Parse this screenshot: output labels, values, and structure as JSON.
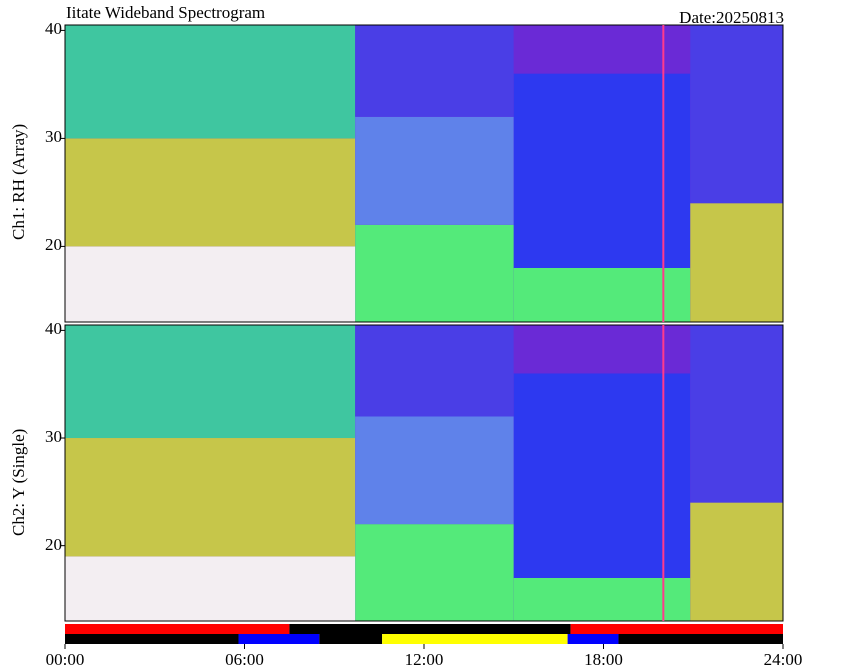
{
  "chart_data": [
    {
      "type": "heatmap",
      "title": "Iitate Wideband Spectrogram",
      "date_label": "Date:20250813",
      "ylabel": "Ch1: RH (Array)",
      "ylim": [
        13,
        40.5
      ],
      "yticks": [
        20,
        30,
        40
      ],
      "xlim": [
        0,
        24
      ],
      "grid": false,
      "regions": [
        {
          "x0": 0,
          "x1": 9.7,
          "y0": 13,
          "y1": 20,
          "level": "white"
        },
        {
          "x0": 0,
          "x1": 9.7,
          "y0": 20,
          "y1": 30,
          "level": "red-green"
        },
        {
          "x0": 0,
          "x1": 9.7,
          "y0": 30,
          "y1": 40.5,
          "level": "green-blue"
        },
        {
          "x0": 9.7,
          "x1": 15,
          "y0": 13,
          "y1": 22,
          "level": "green"
        },
        {
          "x0": 9.7,
          "x1": 15,
          "y0": 22,
          "y1": 32,
          "level": "light-blue"
        },
        {
          "x0": 9.7,
          "x1": 15,
          "y0": 32,
          "y1": 40.5,
          "level": "blue-purple"
        },
        {
          "x0": 15,
          "x1": 20.9,
          "y0": 13,
          "y1": 18,
          "level": "green"
        },
        {
          "x0": 15,
          "x1": 20.9,
          "y0": 18,
          "y1": 36,
          "level": "blue"
        },
        {
          "x0": 15,
          "x1": 20.9,
          "y0": 36,
          "y1": 40.5,
          "level": "purple"
        },
        {
          "x0": 20.9,
          "x1": 24,
          "y0": 13,
          "y1": 24,
          "level": "red-green"
        },
        {
          "x0": 20.9,
          "x1": 24,
          "y0": 24,
          "y1": 40.5,
          "level": "blue-purple"
        }
      ]
    },
    {
      "type": "heatmap",
      "ylabel": "Ch2: Y (Single)",
      "ylim": [
        13,
        40.5
      ],
      "yticks": [
        20,
        30,
        40
      ],
      "xlim": [
        0,
        24
      ],
      "xticks": [
        0,
        6,
        12,
        18,
        24
      ],
      "xtick_labels": [
        "00:00",
        "06:00",
        "12:00",
        "18:00",
        "24:00"
      ],
      "grid": false,
      "regions": [
        {
          "x0": 0,
          "x1": 9.7,
          "y0": 13,
          "y1": 19,
          "level": "white"
        },
        {
          "x0": 0,
          "x1": 9.7,
          "y0": 19,
          "y1": 30,
          "level": "red-green"
        },
        {
          "x0": 0,
          "x1": 9.7,
          "y0": 30,
          "y1": 40.5,
          "level": "green-blue"
        },
        {
          "x0": 9.7,
          "x1": 15,
          "y0": 13,
          "y1": 22,
          "level": "green"
        },
        {
          "x0": 9.7,
          "x1": 15,
          "y0": 22,
          "y1": 32,
          "level": "light-blue"
        },
        {
          "x0": 9.7,
          "x1": 15,
          "y0": 32,
          "y1": 40.5,
          "level": "blue-purple"
        },
        {
          "x0": 15,
          "x1": 20.9,
          "y0": 13,
          "y1": 17,
          "level": "green"
        },
        {
          "x0": 15,
          "x1": 20.9,
          "y0": 17,
          "y1": 36,
          "level": "blue"
        },
        {
          "x0": 15,
          "x1": 20.9,
          "y0": 36,
          "y1": 40.5,
          "level": "purple"
        },
        {
          "x0": 20.9,
          "x1": 24,
          "y0": 13,
          "y1": 24,
          "level": "red-green"
        },
        {
          "x0": 20.9,
          "x1": 24,
          "y0": 24,
          "y1": 40.5,
          "level": "blue-purple"
        }
      ]
    }
  ],
  "time_bars": {
    "top": [
      {
        "start": 0,
        "end": 7.5,
        "color": "#ff0000"
      },
      {
        "start": 7.5,
        "end": 16.9,
        "color": "#000000"
      },
      {
        "start": 16.9,
        "end": 24,
        "color": "#ff0000"
      }
    ],
    "bottom": [
      {
        "start": 0,
        "end": 5.8,
        "color": "#000000"
      },
      {
        "start": 5.8,
        "end": 8.5,
        "color": "#0000ff"
      },
      {
        "start": 8.5,
        "end": 10.6,
        "color": "#000000"
      },
      {
        "start": 10.6,
        "end": 16.8,
        "color": "#ffff00"
      },
      {
        "start": 16.8,
        "end": 18.5,
        "color": "#0000ff"
      },
      {
        "start": 18.5,
        "end": 24,
        "color": "#000000"
      }
    ]
  },
  "spike": {
    "x": 20,
    "color": "#ff3a8c"
  },
  "palette": {
    "purple": "#6a2ad6",
    "blue-purple": "#4a3ee6",
    "blue": "#2d39f0",
    "light-blue": "#5f82ea",
    "green": "#54ea7a",
    "green-blue": "#3fc6a0",
    "red-green": "#c6c64a",
    "white": "#f3eef2"
  }
}
